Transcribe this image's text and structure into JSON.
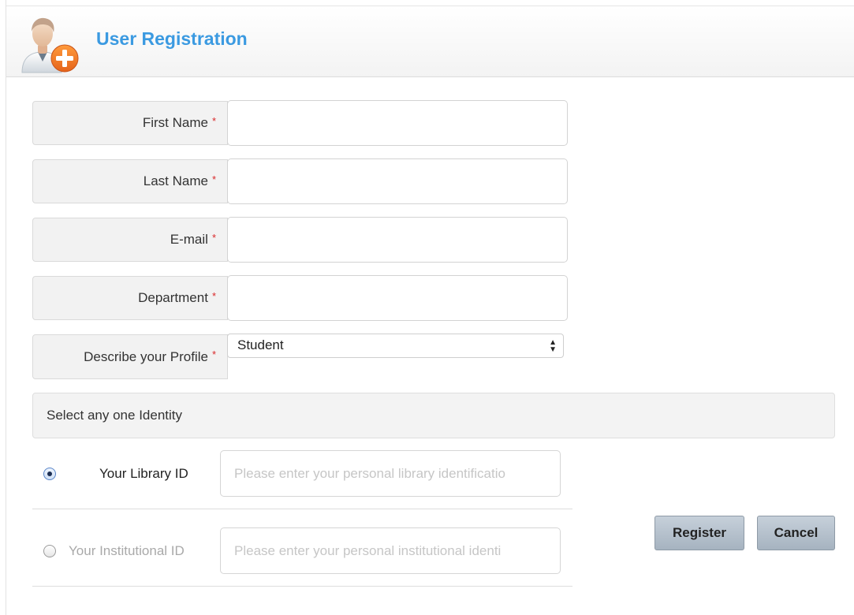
{
  "header": {
    "title": "User Registration",
    "icon": "add-user-icon"
  },
  "form": {
    "required_mark": "*",
    "fields": [
      {
        "label": "First Name",
        "value": ""
      },
      {
        "label": "Last Name",
        "value": ""
      },
      {
        "label": "E-mail",
        "value": ""
      },
      {
        "label": "Department",
        "value": ""
      }
    ],
    "profile": {
      "label": "Describe your Profile",
      "selected": "Student"
    }
  },
  "identity": {
    "heading": "Select any one Identity",
    "library": {
      "label": "Your Library ID",
      "placeholder": "Please enter your personal library identificatio",
      "selected": true
    },
    "institutional": {
      "label": "Your Institutional ID",
      "placeholder": "Please enter your personal institutional identi",
      "selected": false
    }
  },
  "buttons": {
    "register": "Register",
    "cancel": "Cancel"
  },
  "colors": {
    "title": "#3b9ae1",
    "required": "#d9282a",
    "button": "#b4c0cc"
  }
}
